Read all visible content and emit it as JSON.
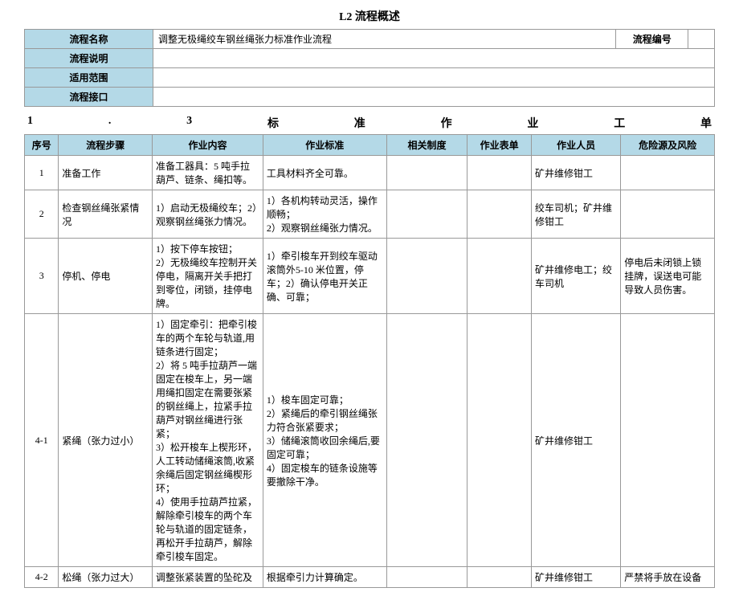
{
  "title": "L2 流程概述",
  "meta": {
    "processNameLabel": "流程名称",
    "processNameValue": "调整无极绳绞车钢丝绳张力标准作业流程",
    "processCodeLabel": "流程编号",
    "processCodeValue": "",
    "processDescLabel": "流程说明",
    "processDescValue": "",
    "scopeLabel": "适用范围",
    "scopeValue": "",
    "interfaceLabel": "流程接口",
    "interfaceValue": ""
  },
  "subheader": {
    "seq": "1",
    "sep": ".",
    "num": "3",
    "c1": "标",
    "c2": "准",
    "c3": "作",
    "c4": "业",
    "c5": "工",
    "c6": "单"
  },
  "headers": {
    "seq": "序号",
    "step": "流程步骤",
    "content": "作业内容",
    "standard": "作业标准",
    "system": "相关制度",
    "form": "作业表单",
    "person": "作业人员",
    "risk": "危险源及风险"
  },
  "rows": [
    {
      "seq": "1",
      "step": "准备工作",
      "content": "准备工器具：5 吨手拉葫芦、链条、绳扣等。",
      "standard": "工具材料齐全可靠。",
      "system": "",
      "form": "",
      "person": "矿井维修钳工",
      "risk": ""
    },
    {
      "seq": "2",
      "step": "检查钢丝绳张紧情况",
      "content": "1）启动无极绳绞车；2）观察钢丝绳张力情况。",
      "standard": "1）各机构转动灵活，操作顺畅；\n2）观察钢丝绳张力情况。",
      "system": "",
      "form": "",
      "person": "绞车司机；矿井维修钳工",
      "risk": ""
    },
    {
      "seq": "3",
      "step": "停机、停电",
      "content": "1）按下停车按钮；\n2）无极绳绞车控制开关停电，隔离开关手把打到零位，闭锁，挂停电牌。",
      "standard": "1）牵引梭车开到绞车驱动滚筒外5-10 米位置，停车；2）确认停电开关正确、可靠；",
      "system": "",
      "form": "",
      "person": "矿井维修电工；绞车司机",
      "risk": "停电后未闭锁上锁挂牌，误送电可能导致人员伤害。"
    },
    {
      "seq": "4-1",
      "step": "紧绳（张力过小）",
      "content": "1）固定牵引：把牵引梭车的两个车轮与轨道,用链条进行固定；\n2）将 5 吨手拉葫芦一端固定在梭车上，另一端用绳扣固定在需要张紧的钢丝绳上，拉紧手拉葫芦对钢丝绳进行张紧；\n3）松开梭车上楔形环，人工转动储绳滚筒,收紧余绳后固定钢丝绳楔形环；\n4）使用手拉葫芦拉紧，解除牵引梭车的两个车轮与轨道的固定链条，再松开手拉葫芦，解除牵引梭车固定。",
      "standard": "1）梭车固定可靠；\n2）紧绳后的牵引钢丝绳张力符合张紧要求；\n3）储绳滚筒收回余绳后,要固定可靠；\n4）固定梭车的链条设施等要撤除干净。",
      "system": "",
      "form": "",
      "person": "矿井维修钳工",
      "risk": ""
    },
    {
      "seq": "4-2",
      "step": "松绳（张力过大）",
      "content": "调整张紧装置的坠砣及",
      "standard": "根据牵引力计算确定。",
      "system": "",
      "form": "",
      "person": "矿井维修钳工",
      "risk": "严禁将手放在设备"
    }
  ]
}
